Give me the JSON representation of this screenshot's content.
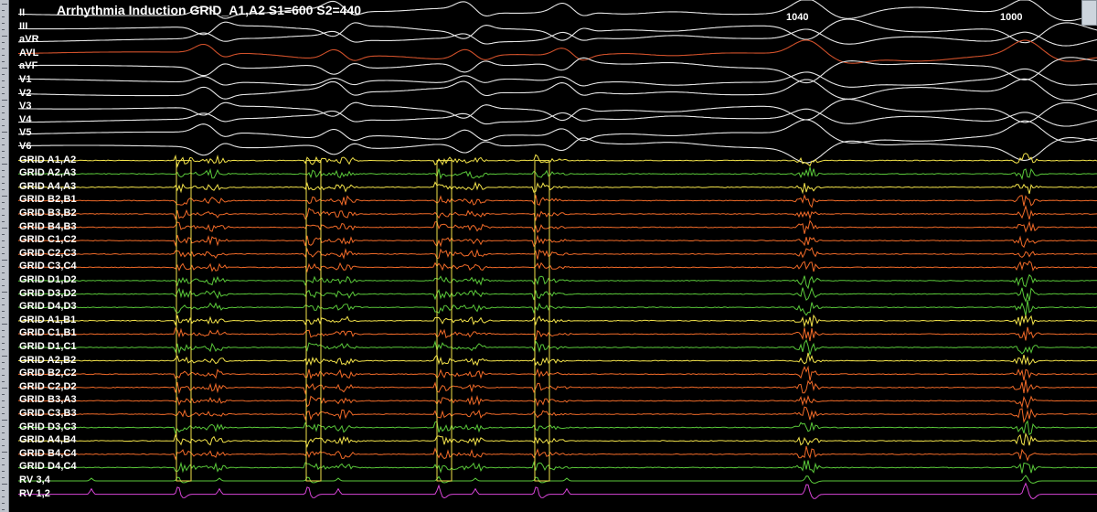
{
  "title": "Arrhythmia Induction GRID_A1,A2 S1=600 S2=440",
  "cycle_lengths": [
    "1040",
    "1000"
  ],
  "colors": {
    "surface": "#e6e6e6",
    "avl": "#d0502a",
    "grid_yellow": "#f2e24a",
    "grid_orange": "#f06a28",
    "grid_green": "#5ac83a",
    "rv": "#d845d8",
    "background": "#000000"
  },
  "leads": [
    {
      "label": "II",
      "color": "surface"
    },
    {
      "label": "III",
      "color": "surface"
    },
    {
      "label": "aVR",
      "color": "surface"
    },
    {
      "label": "AVL",
      "color": "avl"
    },
    {
      "label": "aVF",
      "color": "surface"
    },
    {
      "label": "V1",
      "color": "surface"
    },
    {
      "label": "V2",
      "color": "surface"
    },
    {
      "label": "V3",
      "color": "surface"
    },
    {
      "label": "V4",
      "color": "surface"
    },
    {
      "label": "V5",
      "color": "surface"
    },
    {
      "label": "V6",
      "color": "surface"
    },
    {
      "label": "GRID A1,A2",
      "color": "grid_yellow"
    },
    {
      "label": "GRID A2,A3",
      "color": "grid_green"
    },
    {
      "label": "GRID A4,A3",
      "color": "grid_yellow"
    },
    {
      "label": "GRID B2,B1",
      "color": "grid_orange"
    },
    {
      "label": "GRID B3,B2",
      "color": "grid_orange"
    },
    {
      "label": "GRID B4,B3",
      "color": "grid_orange"
    },
    {
      "label": "GRID C1,C2",
      "color": "grid_orange"
    },
    {
      "label": "GRID C2,C3",
      "color": "grid_orange"
    },
    {
      "label": "GRID C3,C4",
      "color": "grid_orange"
    },
    {
      "label": "GRID D1,D2",
      "color": "grid_green"
    },
    {
      "label": "GRID D3,D2",
      "color": "grid_green"
    },
    {
      "label": "GRID D4,D3",
      "color": "grid_green"
    },
    {
      "label": "GRID A1,B1",
      "color": "grid_yellow"
    },
    {
      "label": "GRID C1,B1",
      "color": "grid_orange"
    },
    {
      "label": "GRID D1,C1",
      "color": "grid_green"
    },
    {
      "label": "GRID A2,B2",
      "color": "grid_yellow"
    },
    {
      "label": "GRID B2,C2",
      "color": "grid_orange"
    },
    {
      "label": "GRID C2,D2",
      "color": "grid_orange"
    },
    {
      "label": "GRID B3,A3",
      "color": "grid_orange"
    },
    {
      "label": "GRID C3,B3",
      "color": "grid_orange"
    },
    {
      "label": "GRID D3,C3",
      "color": "grid_green"
    },
    {
      "label": "GRID A4,B4",
      "color": "grid_yellow"
    },
    {
      "label": "GRID B4,C4",
      "color": "grid_orange"
    },
    {
      "label": "GRID D4,C4",
      "color": "grid_green"
    },
    {
      "label": "RV 3,4",
      "color": "grid_green"
    },
    {
      "label": "RV 1,2",
      "color": "rv"
    }
  ]
}
